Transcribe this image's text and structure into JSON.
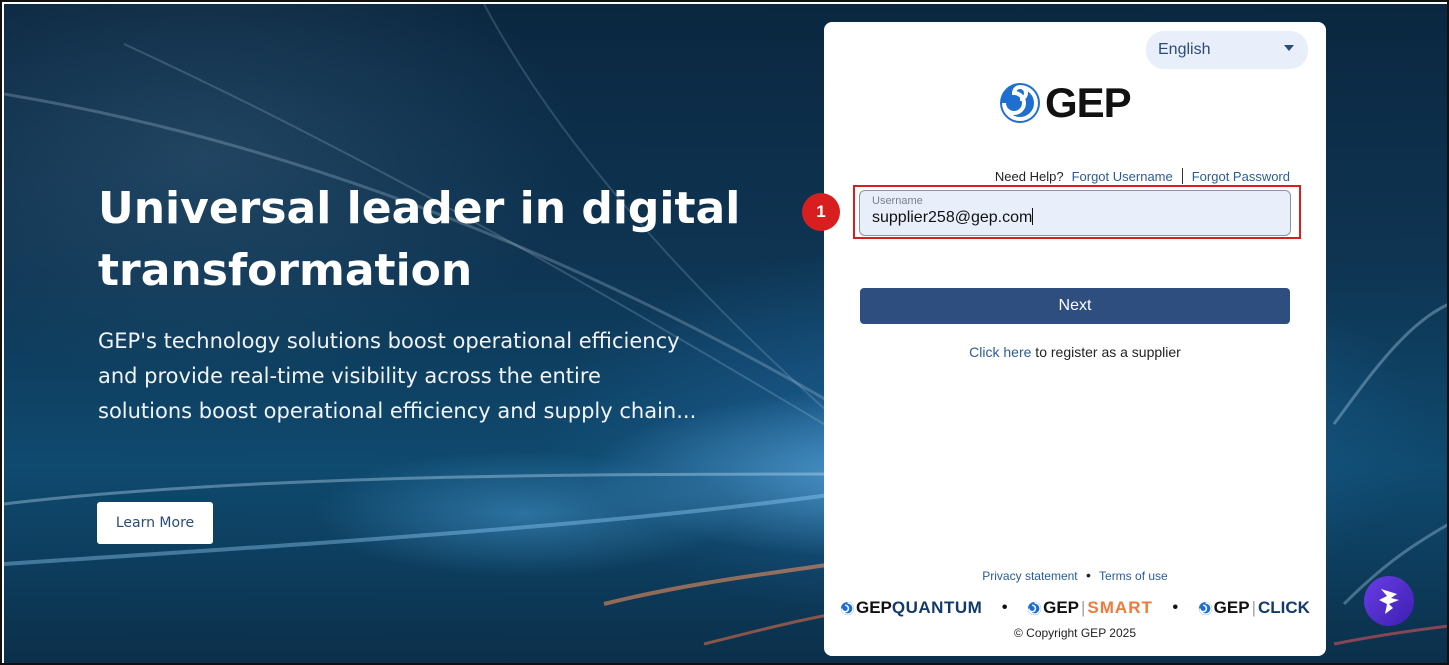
{
  "hero": {
    "title": "Universal leader in digital transformation",
    "description": "GEP's technology solutions boost operational efficiency and provide real-time visibility across the entire solutions boost operational efficiency and supply chain...",
    "learn_more_label": "Learn More"
  },
  "login": {
    "language": "English",
    "logo_text": "GEP",
    "need_help": "Need Help?",
    "forgot_username": "Forgot Username",
    "forgot_password": "Forgot Password",
    "username_label": "Username",
    "username_value": "supplier258@gep.com",
    "next_label": "Next",
    "register_link": "Click here",
    "register_text": " to register as a supplier",
    "privacy": "Privacy statement",
    "terms": "Terms of use",
    "copyright": "© Copyright GEP 2025"
  },
  "brands": {
    "gep": "GEP",
    "quantum": "QUANTUM",
    "smart": "SMART",
    "click": "CLICK"
  },
  "annotation": {
    "step_number": "1"
  },
  "colors": {
    "primary_button": "#2d4e7e",
    "link": "#2a5c9a",
    "highlight": "#d81e1e",
    "smart_orange": "#ef7a3a"
  }
}
